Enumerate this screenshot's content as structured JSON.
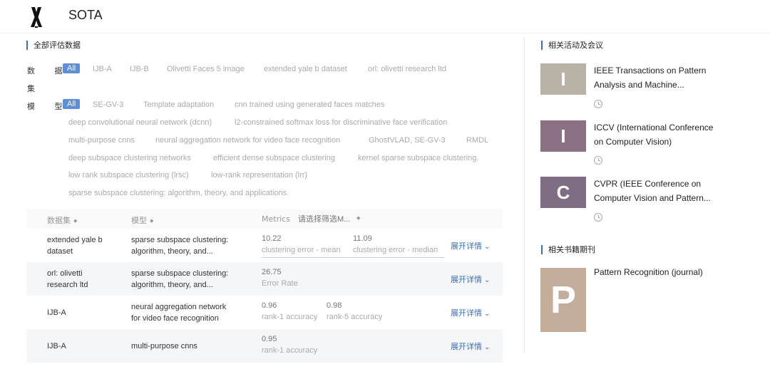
{
  "header": {
    "title": "SOTA",
    "logo_icon": "tripod-logo-icon"
  },
  "main": {
    "section_title": "全部评估数据",
    "dataset_filter": {
      "label_lines": [
        "数 据",
        "集"
      ],
      "chips": [
        "All",
        "IJB-A",
        "IJB-B",
        "Olivetti Faces 5 image",
        "extended yale b dataset",
        "orl: olivetti research ltd"
      ]
    },
    "model_filter": {
      "label": "模 型",
      "chips": [
        "All",
        "SE-GV-3",
        "Template adaptation",
        "cnn trained using generated faces matches",
        "deep convolutional neural network (dcnn)",
        "l2-constrained softmax loss for discriminative face verification",
        "multi-purpose cnns",
        "neural aggregation network for video face recognition",
        "GhostVLAD, SE-GV-3",
        "RMDL",
        "deep subspace clustering networks",
        "efficient dense subspace clustering",
        "kernel sparse subspace clustering.",
        "low rank subspace clustering (lrsc)",
        "low-rank representation (lrr)",
        "sparse subspace clustering: algorithm, theory, and applications."
      ]
    },
    "table": {
      "headers": {
        "dataset": "数据集",
        "model": "模型",
        "metrics": "Metrics",
        "filter_placeholder": "请选择筛选M..."
      },
      "sort_glyph": "◆",
      "expand_label": "展开详情",
      "rows": [
        {
          "dataset": [
            "extended yale b",
            "dataset"
          ],
          "model": [
            "sparse subspace clustering:",
            "algorithm, theory, and..."
          ],
          "metrics": [
            {
              "value": "10.22",
              "name": "clustering error - mean"
            },
            {
              "value": "11.09",
              "name": "clustering error - median"
            }
          ]
        },
        {
          "dataset": [
            "orl: olivetti",
            "research ltd"
          ],
          "model": [
            "sparse subspace clustering:",
            "algorithm, theory, and..."
          ],
          "metrics": [
            {
              "value": "26.75",
              "name": "Error Rate"
            }
          ]
        },
        {
          "dataset": [
            "IJB-A"
          ],
          "model": [
            "neural aggregation network",
            "for video face recognition"
          ],
          "metrics": [
            {
              "value": "0.96",
              "name": "rank-1 accuracy"
            },
            {
              "value": "0.98",
              "name": "rank-5 accuracy"
            }
          ]
        },
        {
          "dataset": [
            "IJB-A"
          ],
          "model": [
            "multi-purpose cnns"
          ],
          "metrics": [
            {
              "value": "0.95",
              "name": "rank-1 accuracy"
            }
          ]
        }
      ]
    }
  },
  "sidebar": {
    "events_title": "相关活动及会议",
    "events": [
      {
        "letter": "I",
        "color": "#b9b2a7",
        "title_lines": [
          "IEEE Transactions on Pattern",
          "Analysis and Machine..."
        ]
      },
      {
        "letter": "I",
        "color": "#8c7185",
        "title_lines": [
          "ICCV (International Conference",
          "on Computer Vision)"
        ]
      },
      {
        "letter": "C",
        "color": "#7f6d84",
        "title_lines": [
          "CVPR (IEEE Conference on",
          "Computer Vision and Pattern..."
        ]
      }
    ],
    "books_title": "相关书籍期刊",
    "books": [
      {
        "letter": "P",
        "color": "#c5ad9b",
        "title": "Pattern Recognition (journal)"
      }
    ]
  }
}
